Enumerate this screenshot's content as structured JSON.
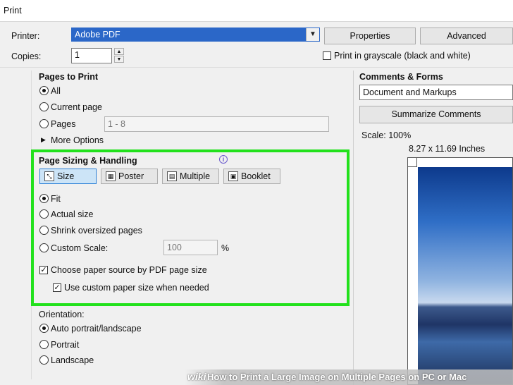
{
  "window": {
    "title": "Print"
  },
  "printer": {
    "label": "Printer:",
    "value": "Adobe PDF",
    "properties_label": "Properties",
    "advanced_label": "Advanced"
  },
  "copies": {
    "label": "Copies:",
    "value": "1"
  },
  "grayscale": {
    "label": "Print in grayscale (black and white)",
    "checked": false
  },
  "pages_to_print": {
    "heading": "Pages to Print",
    "all_label": "All",
    "current_label": "Current page",
    "pages_label": "Pages",
    "pages_value": "1 - 8",
    "more_options_label": "More Options",
    "selected": "all"
  },
  "sizing": {
    "heading": "Page Sizing & Handling",
    "info_icon": "info-icon",
    "tabs": [
      {
        "label": "Size",
        "icon": "size-icon",
        "active": true
      },
      {
        "label": "Poster",
        "icon": "poster-icon",
        "active": false
      },
      {
        "label": "Multiple",
        "icon": "multiple-icon",
        "active": false
      },
      {
        "label": "Booklet",
        "icon": "booklet-icon",
        "active": false
      }
    ],
    "fit_label": "Fit",
    "actual_label": "Actual size",
    "shrink_label": "Shrink oversized pages",
    "custom_label": "Custom Scale:",
    "custom_value": "100",
    "percent": "%",
    "source_label": "Choose paper source by PDF page size",
    "custom_paper_label": "Use custom paper size when needed",
    "selected": "fit",
    "highlight_color": "#22e11c"
  },
  "orientation": {
    "heading": "Orientation:",
    "auto_label": "Auto portrait/landscape",
    "portrait_label": "Portrait",
    "landscape_label": "Landscape",
    "selected": "auto"
  },
  "comments": {
    "heading": "Comments & Forms",
    "value": "Document and Markups",
    "summarize_label": "Summarize Comments"
  },
  "preview": {
    "scale": "Scale: 100%",
    "size": "8.27 x 11.69 Inches"
  },
  "watermark": {
    "brand": "wiki",
    "text": "How to Print a Large Image on Multiple Pages on PC or Mac"
  },
  "colors": {
    "selection_blue": "#2b67c8",
    "green_outline": "#22e11c"
  }
}
